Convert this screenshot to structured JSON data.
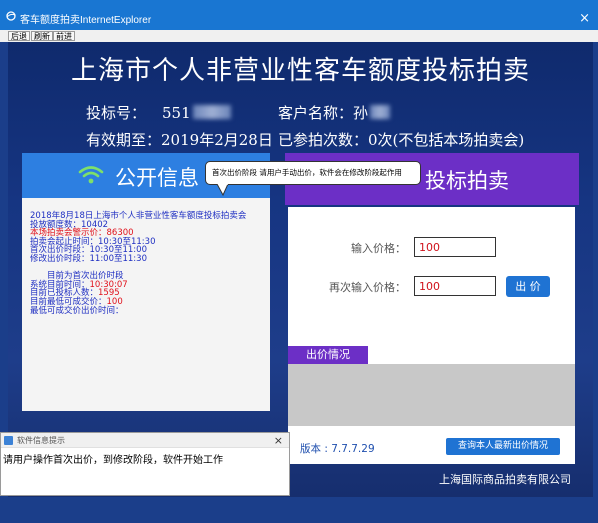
{
  "window": {
    "title": "客车额度拍卖InternetExplorer",
    "close": "×"
  },
  "toolbar": {
    "back": "后退",
    "refresh": "刷新",
    "forward": "前进"
  },
  "page": {
    "heading": "上海市个人非营业性客车额度投标拍卖",
    "bid_no_label": "投标号：",
    "bid_no_value": "551",
    "client_label": "客户名称：",
    "client_value": "孙",
    "valid_label": "有效期至：",
    "valid_value": "2019年2月28日",
    "participated_label": "已参拍次数：",
    "participated_value": "0次(不包括本场拍卖会)"
  },
  "public_info": {
    "title": "公开信息",
    "lines": [
      {
        "text": "2018年8月18日上海市个人非营业性客车额度投标拍卖会",
        "style": "blue"
      },
      {
        "text": "投放额度数：10402",
        "style": "blue"
      },
      {
        "text": "本场拍卖会警示价：86300",
        "style": "red"
      },
      {
        "text": "拍卖会起止时间：10:30至11:30",
        "style": "blue"
      },
      {
        "text": "首次出价时段：10:30至11:00",
        "style": "blue"
      },
      {
        "text": "修改出价时段：11:00至11:30",
        "style": "blue"
      },
      {
        "text": "",
        "style": "blue"
      },
      {
        "text": "　　目前为首次出价时段",
        "style": "blue"
      },
      {
        "text": "系统目前时间：10:30:07",
        "style": "mixed",
        "label": "系统目前时间：",
        "value": "10:30:07"
      },
      {
        "text": "目前已投标人数：1595",
        "style": "mixed",
        "label": "目前已投标人数：",
        "value": "1595"
      },
      {
        "text": "目前最低可成交价：100",
        "style": "mixed",
        "label": "目前最低可成交价：",
        "value": "100"
      },
      {
        "text": "最低可成交价出价时间：",
        "style": "blue"
      }
    ]
  },
  "bidding": {
    "title": "投标拍卖",
    "price_label": "输入价格：",
    "price_value": "100",
    "repeat_label": "再次输入价格：",
    "repeat_value": "100",
    "bid_button": "出 价",
    "status_tab": "出价情况",
    "version": "版本 : 7.7.7.29",
    "query_button": "查询本人最新出价情况"
  },
  "tooltip": "首次出价阶段 请用户手动出价，软件会在修改阶段起作用",
  "company": "上海国际商品拍卖有限公司",
  "popup": {
    "title": "软件信息提示",
    "close": "×",
    "message": "请用户操作首次出价，到修改阶段，软件开始工作"
  },
  "colors": {
    "accent_blue": "#2d7fe1",
    "accent_purple": "#6c2fc6",
    "warning_red": "#e0101a"
  }
}
